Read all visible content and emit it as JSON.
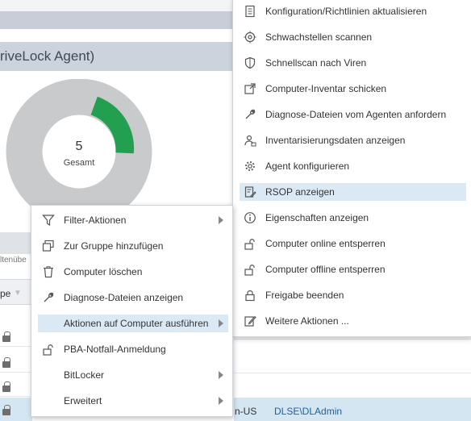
{
  "panel": {
    "title": "riveLock Agent)",
    "donut_total": "5",
    "donut_label": "Gesamt"
  },
  "chart_colors": {
    "green": "#22a050",
    "gray": "#c9cacc"
  },
  "table": {
    "header_text": "ltenübe",
    "col_header": "pe",
    "selected_row": {
      "lang": "n-US",
      "user": "DLSE\\DLAdmin"
    }
  },
  "right_menu": {
    "items": [
      {
        "label": "Konfiguration/Richtlinien aktualisieren",
        "icon": "config-refresh-icon"
      },
      {
        "label": "Schwachstellen scannen",
        "icon": "target-icon"
      },
      {
        "label": "Schnellscan nach Viren",
        "icon": "shield-icon"
      },
      {
        "label": "Computer-Inventar schicken",
        "icon": "send-inventory-icon"
      },
      {
        "label": "Diagnose-Dateien vom Agenten anfordern",
        "icon": "wrench-icon"
      },
      {
        "label": "Inventarisierungsdaten anzeigen",
        "icon": "inventory-icon"
      },
      {
        "label": "Agent konfigurieren",
        "icon": "gear-icon"
      },
      {
        "label": "RSOP anzeigen",
        "icon": "rsop-icon"
      },
      {
        "label": "Eigenschaften anzeigen",
        "icon": "info-icon"
      },
      {
        "label": "Computer online entsperren",
        "icon": "unlock-icon"
      },
      {
        "label": "Computer offline entsperren",
        "icon": "unlock-offline-icon"
      },
      {
        "label": "Freigabe beenden",
        "icon": "lock-icon"
      },
      {
        "label": "Weitere Aktionen ...",
        "icon": "edit-icon"
      }
    ]
  },
  "left_menu": {
    "items": [
      {
        "label": "Filter-Aktionen",
        "icon": "filter-icon",
        "submenu": true
      },
      {
        "label": "Zur Gruppe hinzufügen",
        "icon": "add-to-group-icon",
        "submenu": false
      },
      {
        "label": "Computer löschen",
        "icon": "trash-icon",
        "submenu": false
      },
      {
        "label": "Diagnose-Dateien anzeigen",
        "icon": "wrench-icon",
        "submenu": false
      },
      {
        "label": "Aktionen auf Computer ausführen",
        "icon": "",
        "submenu": true
      },
      {
        "label": "PBA-Notfall-Anmeldung",
        "icon": "unlock-icon",
        "submenu": false
      },
      {
        "label": "BitLocker",
        "icon": "",
        "submenu": true
      },
      {
        "label": "Erweitert",
        "icon": "",
        "submenu": true
      }
    ]
  }
}
